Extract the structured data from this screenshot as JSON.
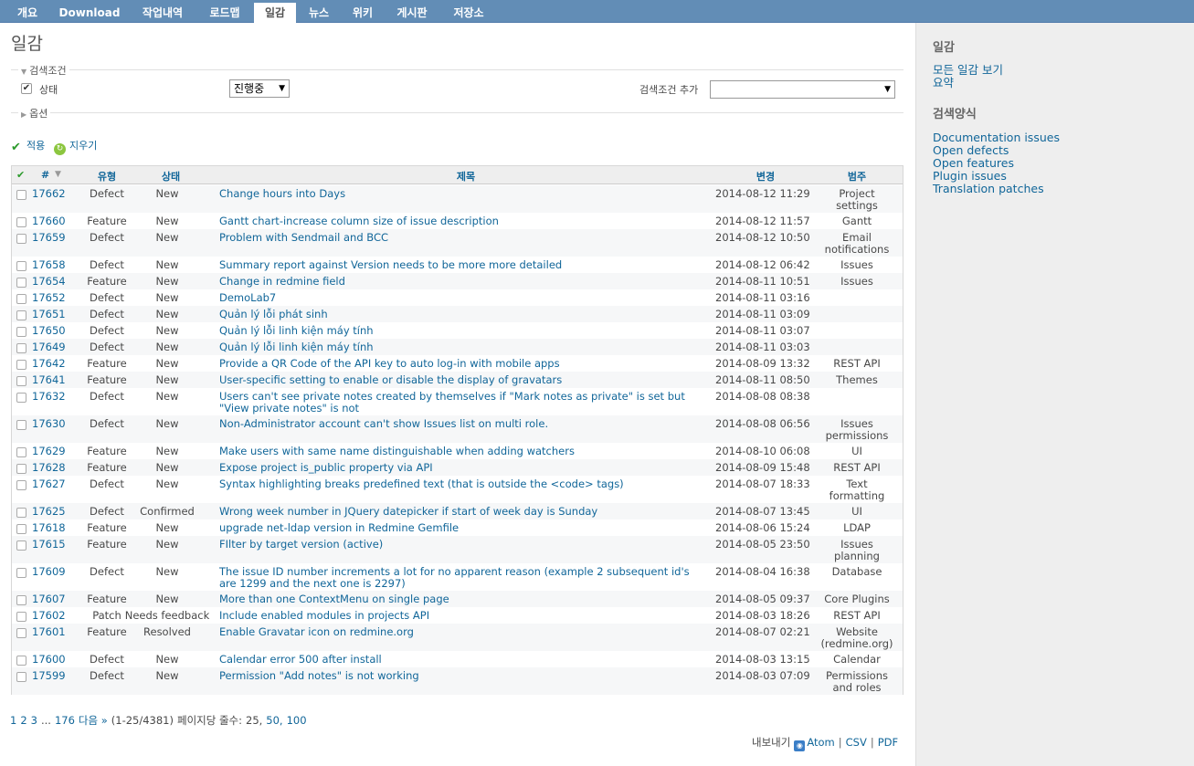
{
  "tabs": [
    {
      "label": "개요",
      "selected": false
    },
    {
      "label": "Download",
      "selected": false
    },
    {
      "label": "작업내역",
      "selected": false
    },
    {
      "label": "로드맵",
      "selected": false
    },
    {
      "label": "일감",
      "selected": true
    },
    {
      "label": "뉴스",
      "selected": false
    },
    {
      "label": "위키",
      "selected": false
    },
    {
      "label": "게시판",
      "selected": false
    },
    {
      "label": "저장소",
      "selected": false
    }
  ],
  "page_title": "일감",
  "filters": {
    "legend": "검색조건",
    "status_label": "상태",
    "status_checked": true,
    "status_value": "진행중",
    "add_filter_label": "검색조건 추가",
    "add_filter_value": ""
  },
  "options": {
    "legend": "옵션"
  },
  "actions": {
    "apply": "적용",
    "clear": "지우기"
  },
  "table": {
    "headers": {
      "id": "#",
      "tracker": "유형",
      "status": "상태",
      "subject": "제목",
      "updated": "변경",
      "category": "범주"
    },
    "rows": [
      {
        "id": "17662",
        "tracker": "Defect",
        "status": "New",
        "subject": "Change hours into Days",
        "updated": "2014-08-12 11:29",
        "category": "Project settings"
      },
      {
        "id": "17660",
        "tracker": "Feature",
        "status": "New",
        "subject": "Gantt chart-increase column size of issue description",
        "updated": "2014-08-12 11:57",
        "category": "Gantt"
      },
      {
        "id": "17659",
        "tracker": "Defect",
        "status": "New",
        "subject": "Problem with Sendmail and BCC",
        "updated": "2014-08-12 10:50",
        "category": "Email notifications"
      },
      {
        "id": "17658",
        "tracker": "Defect",
        "status": "New",
        "subject": "Summary report against Version needs to be more more detailed",
        "updated": "2014-08-12 06:42",
        "category": "Issues"
      },
      {
        "id": "17654",
        "tracker": "Feature",
        "status": "New",
        "subject": "Change in redmine field",
        "updated": "2014-08-11 10:51",
        "category": "Issues"
      },
      {
        "id": "17652",
        "tracker": "Defect",
        "status": "New",
        "subject": "DemoLab7",
        "updated": "2014-08-11 03:16",
        "category": ""
      },
      {
        "id": "17651",
        "tracker": "Defect",
        "status": "New",
        "subject": "Quản lý lỗi phát sinh",
        "updated": "2014-08-11 03:09",
        "category": ""
      },
      {
        "id": "17650",
        "tracker": "Defect",
        "status": "New",
        "subject": "Quản lý lỗi linh kiện máy tính",
        "updated": "2014-08-11 03:07",
        "category": ""
      },
      {
        "id": "17649",
        "tracker": "Defect",
        "status": "New",
        "subject": "Quản lý lỗi linh kiện máy tính",
        "updated": "2014-08-11 03:03",
        "category": ""
      },
      {
        "id": "17642",
        "tracker": "Feature",
        "status": "New",
        "subject": "Provide a QR Code of the API key to auto log-in with mobile apps",
        "updated": "2014-08-09 13:32",
        "category": "REST API"
      },
      {
        "id": "17641",
        "tracker": "Feature",
        "status": "New",
        "subject": "User-specific setting to enable or disable the display of gravatars",
        "updated": "2014-08-11 08:50",
        "category": "Themes"
      },
      {
        "id": "17632",
        "tracker": "Defect",
        "status": "New",
        "subject": "Users can't see private notes created by themselves if \"Mark notes as private\" is set but \"View private notes\" is not",
        "updated": "2014-08-08 08:38",
        "category": ""
      },
      {
        "id": "17630",
        "tracker": "Defect",
        "status": "New",
        "subject": "Non-Administrator account can't show Issues list on multi role.",
        "updated": "2014-08-08 06:56",
        "category": "Issues permissions"
      },
      {
        "id": "17629",
        "tracker": "Feature",
        "status": "New",
        "subject": "Make users with same name distinguishable when adding watchers",
        "updated": "2014-08-10 06:08",
        "category": "UI"
      },
      {
        "id": "17628",
        "tracker": "Feature",
        "status": "New",
        "subject": "Expose project is_public property via API",
        "updated": "2014-08-09 15:48",
        "category": "REST API"
      },
      {
        "id": "17627",
        "tracker": "Defect",
        "status": "New",
        "subject": "Syntax highlighting breaks predefined text (that is outside the <code> tags)",
        "updated": "2014-08-07 18:33",
        "category": "Text formatting"
      },
      {
        "id": "17625",
        "tracker": "Defect",
        "status": "Confirmed",
        "subject": "Wrong week number in JQuery datepicker if start of week day is Sunday",
        "updated": "2014-08-07 13:45",
        "category": "UI"
      },
      {
        "id": "17618",
        "tracker": "Feature",
        "status": "New",
        "subject": "upgrade net-ldap version in Redmine Gemfile",
        "updated": "2014-08-06 15:24",
        "category": "LDAP"
      },
      {
        "id": "17615",
        "tracker": "Feature",
        "status": "New",
        "subject": "FIlter by target version (active)",
        "updated": "2014-08-05 23:50",
        "category": "Issues planning"
      },
      {
        "id": "17609",
        "tracker": "Defect",
        "status": "New",
        "subject": "The issue ID number increments a lot for no apparent reason (example 2 subsequent id's are 1299 and the next one is 2297)",
        "updated": "2014-08-04 16:38",
        "category": "Database"
      },
      {
        "id": "17607",
        "tracker": "Feature",
        "status": "New",
        "subject": "More than one ContextMenu on single page",
        "updated": "2014-08-05 09:37",
        "category": "Core Plugins"
      },
      {
        "id": "17602",
        "tracker": "Patch",
        "status": "Needs feedback",
        "subject": "Include enabled modules in projects API",
        "updated": "2014-08-03 18:26",
        "category": "REST API"
      },
      {
        "id": "17601",
        "tracker": "Feature",
        "status": "Resolved",
        "subject": "Enable Gravatar icon on redmine.org",
        "updated": "2014-08-07 02:21",
        "category": "Website (redmine.org)"
      },
      {
        "id": "17600",
        "tracker": "Defect",
        "status": "New",
        "subject": "Calendar error 500 after install",
        "updated": "2014-08-03 13:15",
        "category": "Calendar"
      },
      {
        "id": "17599",
        "tracker": "Defect",
        "status": "New",
        "subject": "Permission \"Add notes\" is not working",
        "updated": "2014-08-03 07:09",
        "category": "Permissions and roles"
      }
    ]
  },
  "pagination": {
    "pages": [
      "1",
      "2",
      "3"
    ],
    "ellipsis": "...",
    "last": "176",
    "next": "다음 »",
    "range": "(1-25/4381)",
    "per_page_label": "페이지당 줄수:",
    "per_page_current": "25,",
    "per_page_options": [
      "50,",
      "100"
    ]
  },
  "export": {
    "label": "내보내기",
    "atom": "Atom",
    "csv": "CSV",
    "pdf": "PDF"
  },
  "sidebar": {
    "issues_title": "일감",
    "issues_links": [
      "모든 일감 보기",
      "요약"
    ],
    "queries_title": "검색양식",
    "queries": [
      "Documentation issues",
      "Open defects",
      "Open features",
      "Plugin issues",
      "Translation patches"
    ]
  },
  "colors": {
    "header_bg": "#628db6",
    "link": "#116699",
    "sidebar_bg": "#eeeeee"
  },
  "icons": {
    "apply": "check-icon",
    "clear": "reload-icon",
    "atom": "feed-icon"
  }
}
